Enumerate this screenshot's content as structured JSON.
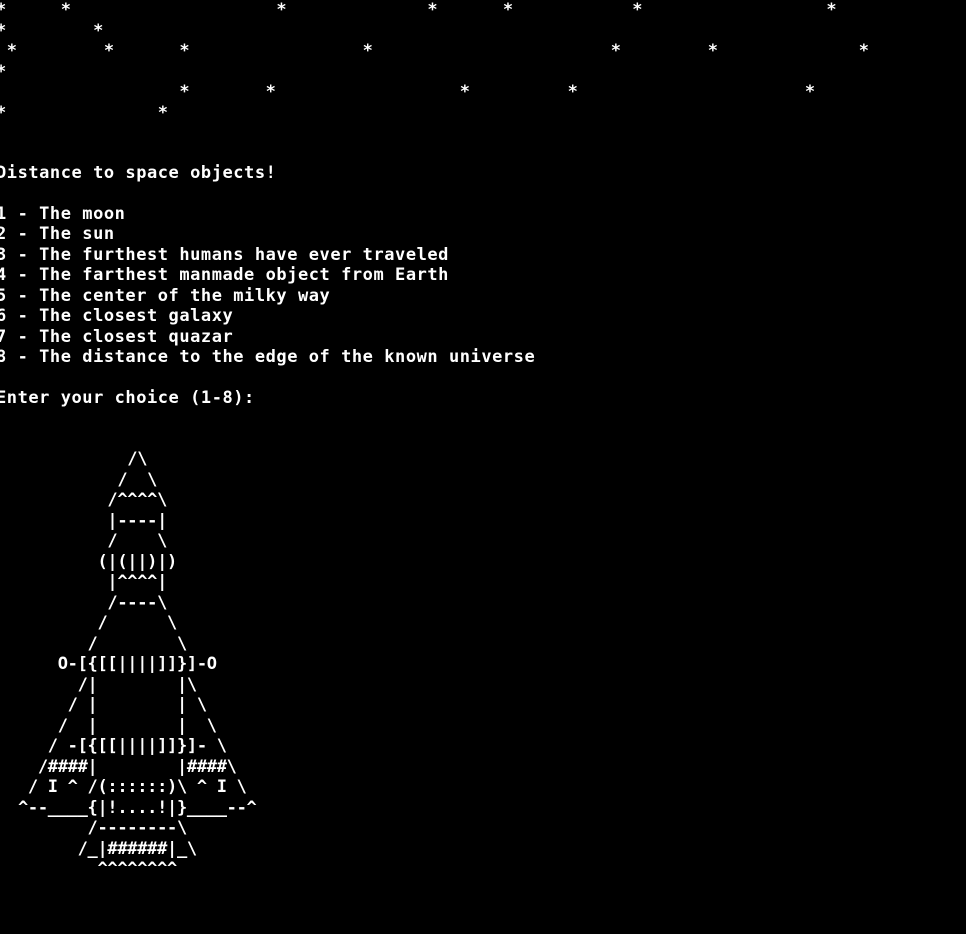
{
  "terminal": {
    "background": "#000000",
    "foreground": "#ffffff",
    "star_rows": [
      "*     *                   *             *      *           *                 *",
      "*        *",
      " *        *      *                *                      *        *             *",
      "*",
      "                 *       *                 *         *                     *",
      "*              *"
    ],
    "heading": "Distance to space objects!",
    "menu": [
      "1 - The moon",
      "2 - The sun",
      "3 - The furthest humans have ever traveled",
      "4 - The farthest manmade object from Earth",
      "5 - The center of the milky way",
      "6 - The closest galaxy",
      "7 - The closest quazar",
      "8 - The distance to the edge of the known universe"
    ],
    "prompt": "Enter your choice (1-8):",
    "rocket_art": "           /\\\n          /  \\\n         /^^^^\\\n         |----|\n         /    \\\n        (|(||)|)\n         |^^^^|\n         /----\\\n        /      \\\n       /        \\\n    O-[{[[||||]]}]-O\n      /|        |\\\n     / |        | \\\n    /  |        |  \\\n   / -[{[[||||]]}]- \\\n  /####|        |####\\\n / I ^ /(::::::)\\ ^ I \\\n^--____{|!....!|}____--^\n       /--------\\\n      /_|######|_\\\n        ^^^^^^^^"
  }
}
